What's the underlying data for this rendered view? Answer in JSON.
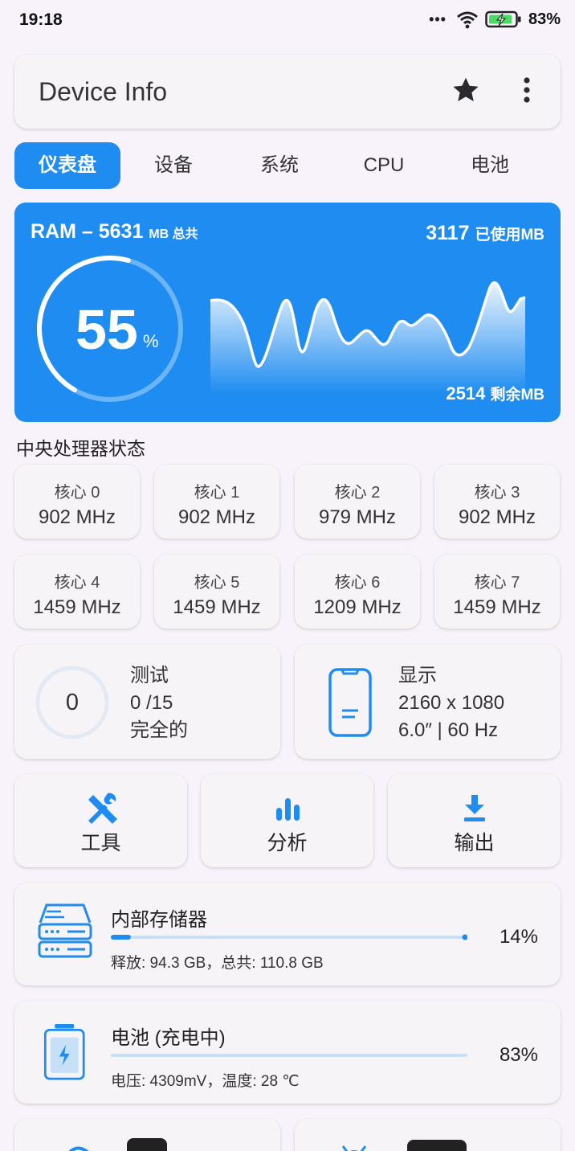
{
  "status_bar": {
    "time": "19:18",
    "dots": "•••",
    "battery_percent": "83%"
  },
  "app_bar": {
    "title": "Device Info",
    "star_icon": "star-icon",
    "more_icon": "more-vert-icon"
  },
  "tabs": [
    {
      "label": "仪表盘",
      "active": true
    },
    {
      "label": "设备",
      "active": false
    },
    {
      "label": "系统",
      "active": false
    },
    {
      "label": "CPU",
      "active": false
    },
    {
      "label": "电池",
      "active": false
    }
  ],
  "ram": {
    "title": "RAM – 5631",
    "title_suffix": "MB 总共",
    "used_value": "3117",
    "used_suffix": "已使用MB",
    "free_value": "2514",
    "free_suffix": "剩余MB",
    "percent": "55",
    "percent_sign": "%",
    "usage_fraction": 0.55
  },
  "cpu_section": {
    "title": "中央处理器状态",
    "cores": [
      {
        "label": "核心 0",
        "value": "902 MHz"
      },
      {
        "label": "核心 1",
        "value": "902 MHz"
      },
      {
        "label": "核心 2",
        "value": "979 MHz"
      },
      {
        "label": "核心 3",
        "value": "902 MHz"
      },
      {
        "label": "核心 4",
        "value": "1459 MHz"
      },
      {
        "label": "核心 5",
        "value": "1459 MHz"
      },
      {
        "label": "核心 6",
        "value": "1209 MHz"
      },
      {
        "label": "核心 7",
        "value": "1459 MHz"
      }
    ]
  },
  "tests": {
    "count": "0",
    "title": "测试",
    "progress": "0 /15",
    "status": "完全的"
  },
  "display": {
    "title": "显示",
    "resolution": "2160 x 1080",
    "details": "6.0″ | 60 Hz"
  },
  "actions": [
    {
      "label": "工具",
      "icon": "tools-icon"
    },
    {
      "label": "分析",
      "icon": "bar-chart-icon"
    },
    {
      "label": "输出",
      "icon": "download-icon"
    }
  ],
  "storage": {
    "title": "内部存储器",
    "details": "释放: 94.3 GB，总共: 110.8 GB",
    "percent": "14%",
    "fraction": 0.14
  },
  "battery": {
    "title": "电池 (充电中)",
    "details": "电压: 4309mV，温度: 28 ℃",
    "percent": "83%",
    "fraction": 0.83
  },
  "colors": {
    "accent": "#1e8cf0",
    "card": "#f7f4f8",
    "background": "#f8f3fa",
    "light_track": "#c6e0f8"
  }
}
